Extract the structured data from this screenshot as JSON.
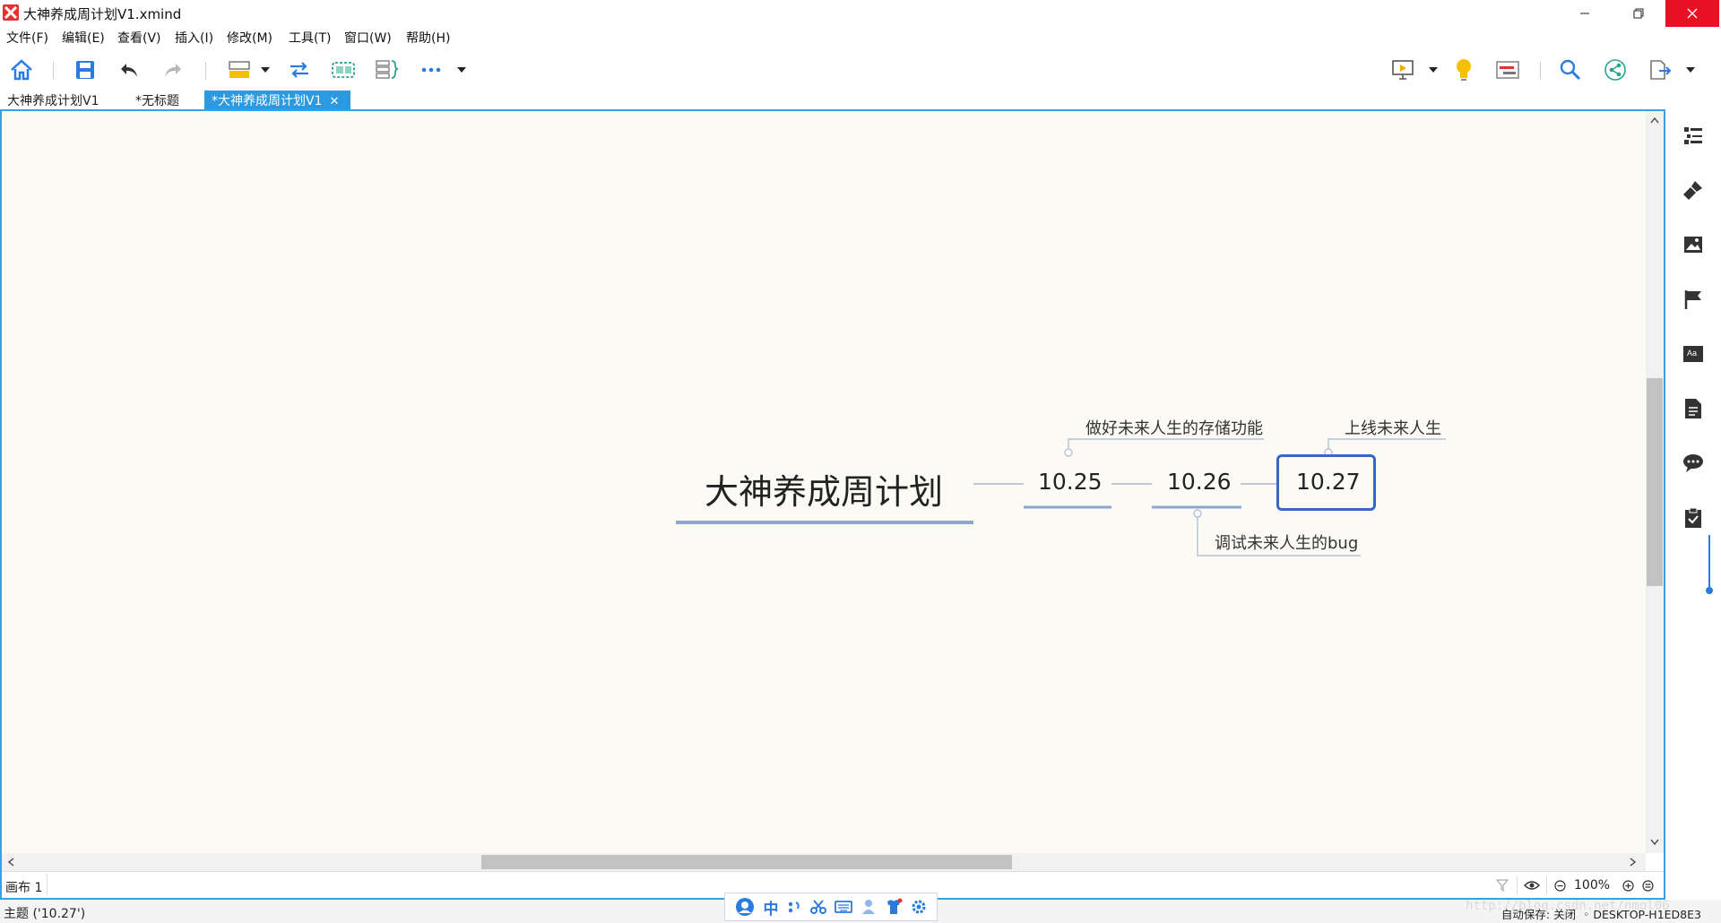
{
  "window": {
    "title": "大神养成周计划V1.xmind"
  },
  "menu": {
    "items": [
      "文件(F)",
      "编辑(E)",
      "查看(V)",
      "插入(I)",
      "修改(M)",
      "工具(T)",
      "窗口(W)",
      "帮助(H)"
    ]
  },
  "toolbar": {
    "icons": [
      "home-icon",
      "save-icon",
      "undo-icon",
      "redo-icon",
      "topic-icon",
      "relationship-icon",
      "boundary-icon",
      "summary-icon",
      "more-icon",
      "presentation-icon",
      "idea-icon",
      "gantt-icon",
      "search-icon",
      "share-icon",
      "export-icon"
    ]
  },
  "tabs": [
    {
      "label": "大神养成计划V1",
      "active": false
    },
    {
      "label": "*无标题",
      "active": false
    },
    {
      "label": "*大神养成周计划V1",
      "active": true,
      "close": "✕"
    }
  ],
  "mindmap": {
    "central": "大神养成周计划",
    "topics": [
      "10.25",
      "10.26",
      "10.27"
    ],
    "callouts": {
      "above_1025": "做好未来人生的存储功能",
      "below_1026": "调试未来人生的bug",
      "above_1027": "上线未来人生"
    },
    "selected": "10.27",
    "accent_color": "#3667c7"
  },
  "sheetbar": {
    "sheet": "画布 1",
    "zoom": "100%"
  },
  "status": {
    "left": "主题 ('10.27')",
    "autosave": "自动保存: 关闭",
    "computer": "DESKTOP-H1ED8E3"
  },
  "ime": {
    "mode": "中"
  },
  "watermark": "http://blog.csdn.net/nmol06"
}
